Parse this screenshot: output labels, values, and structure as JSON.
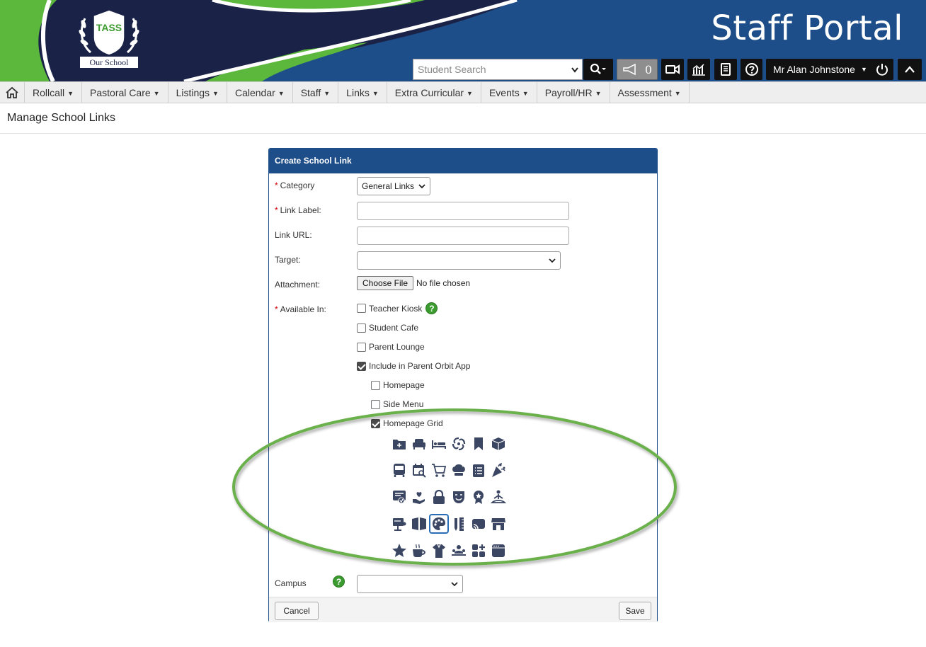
{
  "header": {
    "logo_name": "TASS",
    "logo_text": "Our School",
    "title": "Staff Portal",
    "search_placeholder": "Student Search",
    "notification_count": "0",
    "user_name": "Mr Alan Johnstone"
  },
  "nav": {
    "items": [
      {
        "label": "Rollcall"
      },
      {
        "label": "Pastoral Care"
      },
      {
        "label": "Listings"
      },
      {
        "label": "Calendar"
      },
      {
        "label": "Staff"
      },
      {
        "label": "Links"
      },
      {
        "label": "Extra Curricular"
      },
      {
        "label": "Events"
      },
      {
        "label": "Payroll/HR"
      },
      {
        "label": "Assessment"
      }
    ]
  },
  "page": {
    "title": "Manage School Links"
  },
  "form": {
    "heading": "Create School Link",
    "category_label": "Category",
    "category_value": "General Links",
    "link_label_label": "Link Label:",
    "link_url_label": "Link URL:",
    "target_label": "Target:",
    "attachment_label": "Attachment:",
    "choose_file": "Choose File",
    "file_status": "No file chosen",
    "available_label": "Available In:",
    "options": {
      "teacher_kiosk": "Teacher Kiosk",
      "student_cafe": "Student Cafe",
      "parent_lounge": "Parent Lounge",
      "parent_orbit": "Include in Parent Orbit App",
      "homepage": "Homepage",
      "side_menu": "Side Menu",
      "homepage_grid": "Homepage Grid"
    },
    "campus_label": "Campus",
    "cancel": "Cancel",
    "save": "Save"
  },
  "icons": [
    [
      "folder-plus-icon",
      "armchair-icon",
      "bed-icon",
      "storm-icon",
      "bookmark-icon",
      "box-icon"
    ],
    [
      "bus-icon",
      "calendar-search-icon",
      "cart-icon",
      "chef-hat-icon",
      "clipboard-list-icon",
      "celebration-icon"
    ],
    [
      "certificate-icon",
      "heart-hand-icon",
      "lock-icon",
      "theatre-mask-icon",
      "award-icon",
      "meditation-icon"
    ],
    [
      "presentation-icon",
      "book-open-icon",
      "palette-icon",
      "pencil-ruler-icon",
      "cast-icon",
      "store-icon"
    ],
    [
      "star-icon",
      "coffee-icon",
      "uniform-icon",
      "people-icon",
      "apps-add-icon",
      "browser-window-icon"
    ]
  ],
  "colors": {
    "brand_blue": "#1d4e89",
    "navy": "#1a2347",
    "green": "#5cb83c",
    "icon": "#3b4663"
  }
}
